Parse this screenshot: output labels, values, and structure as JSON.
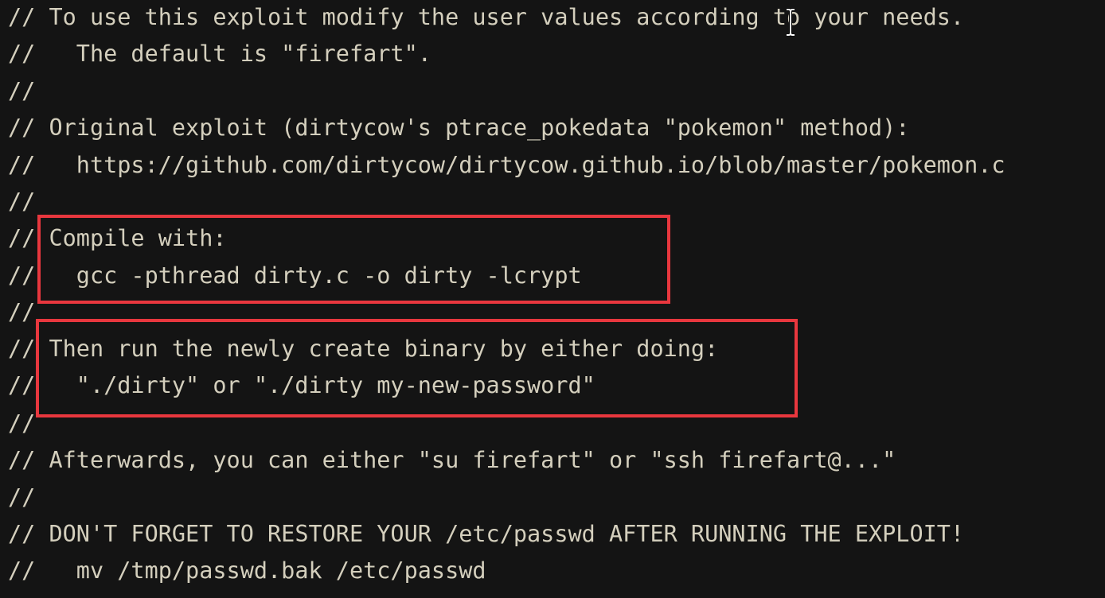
{
  "comment_lines": [
    "// To use this exploit modify the user values according to your needs.",
    "//   The default is \"firefart\".",
    "//",
    "// Original exploit (dirtycow's ptrace_pokedata \"pokemon\" method):",
    "//   https://github.com/dirtycow/dirtycow.github.io/blob/master/pokemon.c",
    "//",
    "// Compile with:",
    "//   gcc -pthread dirty.c -o dirty -lcrypt",
    "//",
    "// Then run the newly create binary by either doing:",
    "//   \"./dirty\" or \"./dirty my-new-password\"",
    "//",
    "// Afterwards, you can either \"su firefart\" or \"ssh firefart@...\"",
    "//",
    "// DON'T FORGET TO RESTORE YOUR /etc/passwd AFTER RUNNING THE EXPLOIT!",
    "//   mv /tmp/passwd.bak /etc/passwd"
  ],
  "annotations": {
    "box_color": "#e8373e"
  },
  "cursor": {
    "icon": "text-ibeam-cursor-icon"
  }
}
